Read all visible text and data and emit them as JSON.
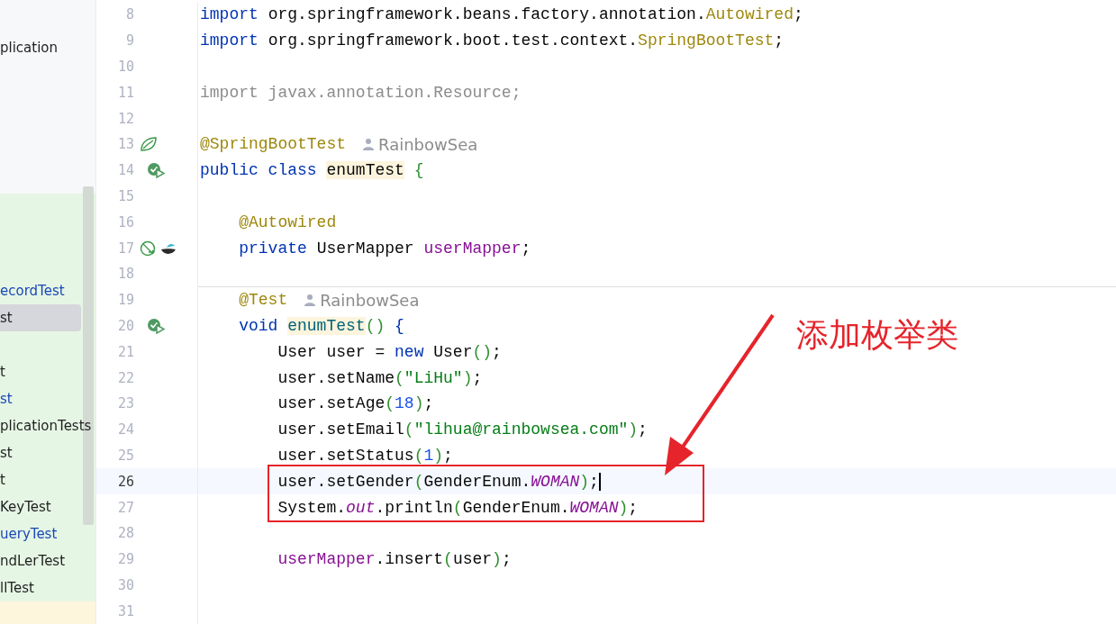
{
  "project_tree": {
    "top_items": [
      {
        "label": "plication",
        "modified": false,
        "selected": false
      }
    ],
    "test_items": [
      {
        "label": "ecordTest",
        "modified": true,
        "selected": false
      },
      {
        "label": "st",
        "modified": false,
        "selected": true
      },
      {
        "label": "t",
        "modified": false,
        "selected": false
      },
      {
        "label": "st",
        "modified": true,
        "selected": false
      },
      {
        "label": "plicationTests",
        "modified": false,
        "selected": false
      },
      {
        "label": "st",
        "modified": false,
        "selected": false
      },
      {
        "label": "t",
        "modified": false,
        "selected": false
      },
      {
        "label": "KeyTest",
        "modified": false,
        "selected": false
      },
      {
        "label": "ueryTest",
        "modified": true,
        "selected": false
      },
      {
        "label": "ndLerTest",
        "modified": false,
        "selected": false
      },
      {
        "label": "llTest",
        "modified": false,
        "selected": false
      }
    ]
  },
  "editor": {
    "lines": [
      {
        "number": "8",
        "tokens": [
          {
            "text": "import ",
            "kind": "keyword"
          },
          {
            "text": "org.springframework.beans.factory.annotation.",
            "kind": "plain"
          },
          {
            "text": "Autowired",
            "kind": "annotation"
          },
          {
            "text": ";",
            "kind": "plain"
          }
        ]
      },
      {
        "number": "9",
        "tokens": [
          {
            "text": "import ",
            "kind": "keyword"
          },
          {
            "text": "org.springframework.boot.test.context.",
            "kind": "plain"
          },
          {
            "text": "SpringBootTest",
            "kind": "annotation"
          },
          {
            "text": ";",
            "kind": "plain"
          }
        ]
      },
      {
        "number": "10"
      },
      {
        "number": "11",
        "tokens": [
          {
            "text": "import javax.annotation.Resource;",
            "kind": "unused"
          }
        ]
      },
      {
        "number": "12"
      },
      {
        "number": "13",
        "gutter": [
          {
            "kind": "spring"
          }
        ],
        "tokens": [
          {
            "text": "@SpringBootTest",
            "kind": "annotation"
          }
        ],
        "author": "RainbowSea"
      },
      {
        "number": "14",
        "gutter": [
          {
            "kind": "run"
          }
        ],
        "tokens": [
          {
            "text": "public class ",
            "kind": "keyword"
          },
          {
            "text": "enumTest",
            "kind": "decl"
          },
          {
            "text": " {",
            "kind": "bracket"
          }
        ]
      },
      {
        "number": "15"
      },
      {
        "number": "16",
        "tokens": [
          {
            "text": "    @Autowired",
            "kind": "annotation"
          }
        ]
      },
      {
        "number": "17",
        "gutter": [
          {
            "kind": "bean"
          },
          {
            "kind": "mybatis"
          }
        ],
        "tokens": [
          {
            "text": "    private ",
            "kind": "keyword"
          },
          {
            "text": "UserMapper ",
            "kind": "plain"
          },
          {
            "text": "userMapper",
            "kind": "field"
          },
          {
            "text": ";",
            "kind": "plain"
          }
        ]
      },
      {
        "number": "18",
        "separator": true
      },
      {
        "number": "19",
        "tokens": [
          {
            "text": "    @Test",
            "kind": "annotation"
          }
        ],
        "author": "RainbowSea"
      },
      {
        "number": "20",
        "gutter": [
          {
            "kind": "run"
          }
        ],
        "tokens": [
          {
            "text": "    void ",
            "kind": "keyword"
          },
          {
            "text": "enumTest",
            "kind": "decl-method"
          },
          {
            "text": "()",
            "kind": "bracket"
          },
          {
            "text": " {",
            "kind": "keyword"
          }
        ]
      },
      {
        "number": "21",
        "tokens": [
          {
            "text": "        User user = ",
            "kind": "plain"
          },
          {
            "text": "new ",
            "kind": "keyword"
          },
          {
            "text": "User",
            "kind": "plain"
          },
          {
            "text": "()",
            "kind": "bracket"
          },
          {
            "text": ";",
            "kind": "plain"
          }
        ]
      },
      {
        "number": "22",
        "tokens": [
          {
            "text": "        user.setName",
            "kind": "plain"
          },
          {
            "text": "(",
            "kind": "bracket"
          },
          {
            "text": "\"LiHu\"",
            "kind": "string"
          },
          {
            "text": ")",
            "kind": "bracket"
          },
          {
            "text": ";",
            "kind": "plain"
          }
        ]
      },
      {
        "number": "23",
        "tokens": [
          {
            "text": "        user.setAge",
            "kind": "plain"
          },
          {
            "text": "(",
            "kind": "bracket"
          },
          {
            "text": "18",
            "kind": "number"
          },
          {
            "text": ")",
            "kind": "bracket"
          },
          {
            "text": ";",
            "kind": "plain"
          }
        ]
      },
      {
        "number": "24",
        "tokens": [
          {
            "text": "        user.setEmail",
            "kind": "plain"
          },
          {
            "text": "(",
            "kind": "bracket"
          },
          {
            "text": "\"lihua@rainbowsea.com\"",
            "kind": "string"
          },
          {
            "text": ")",
            "kind": "bracket"
          },
          {
            "text": ";",
            "kind": "plain"
          }
        ]
      },
      {
        "number": "25",
        "tokens": [
          {
            "text": "        user.setStatus",
            "kind": "plain"
          },
          {
            "text": "(",
            "kind": "bracket"
          },
          {
            "text": "1",
            "kind": "number"
          },
          {
            "text": ")",
            "kind": "bracket"
          },
          {
            "text": ";",
            "kind": "plain"
          }
        ]
      },
      {
        "number": "26",
        "current": true,
        "caret": true,
        "tokens": [
          {
            "text": "        user.setGender",
            "kind": "plain"
          },
          {
            "text": "(",
            "kind": "bracket"
          },
          {
            "text": "GenderEnum.",
            "kind": "plain"
          },
          {
            "text": "WOMAN",
            "kind": "static"
          },
          {
            "text": ")",
            "kind": "bracket"
          },
          {
            "text": ";",
            "kind": "plain"
          }
        ]
      },
      {
        "number": "27",
        "tokens": [
          {
            "text": "        System.",
            "kind": "plain"
          },
          {
            "text": "out",
            "kind": "static"
          },
          {
            "text": ".println",
            "kind": "plain"
          },
          {
            "text": "(",
            "kind": "bracket"
          },
          {
            "text": "GenderEnum.",
            "kind": "plain"
          },
          {
            "text": "WOMAN",
            "kind": "static"
          },
          {
            "text": ")",
            "kind": "bracket"
          },
          {
            "text": ";",
            "kind": "plain"
          }
        ]
      },
      {
        "number": "28"
      },
      {
        "number": "29",
        "tokens": [
          {
            "text": "        userMapper",
            "kind": "field"
          },
          {
            "text": ".insert",
            "kind": "plain"
          },
          {
            "text": "(",
            "kind": "bracket"
          },
          {
            "text": "user",
            "kind": "plain"
          },
          {
            "text": ")",
            "kind": "bracket"
          },
          {
            "text": ";",
            "kind": "plain"
          }
        ]
      },
      {
        "number": "30"
      },
      {
        "number": "31"
      }
    ]
  },
  "callout": {
    "text": "添加枚举类"
  }
}
